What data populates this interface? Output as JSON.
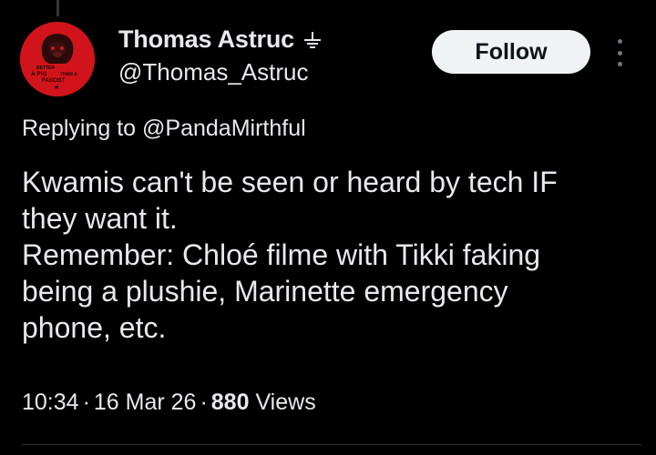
{
  "author": {
    "display_name": "Thomas Astruc",
    "handle": "@Thomas_Astruc",
    "avatar_text": "BETTER A PIG THAN A FASCIST"
  },
  "actions": {
    "follow_label": "Follow",
    "more_icon": "more-vertical-icon"
  },
  "reply_context": {
    "text": "Replying to @PandaMirthful"
  },
  "tweet": {
    "lines": [
      "Kwamis can't be seen or heard by tech IF",
      "they want it.",
      "Remember:  Chloé filme with Tikki faking",
      "being a plushie, Marinette emergency",
      "phone, etc."
    ]
  },
  "meta": {
    "time": "10:34",
    "separator": "·",
    "date": "16 Mar 26",
    "views_count": "880",
    "views_label": "Views"
  },
  "colors": {
    "background": "#000000",
    "text": "#e7e9ea",
    "follow_bg": "#eff3f4",
    "avatar_bg": "#d1141b"
  }
}
